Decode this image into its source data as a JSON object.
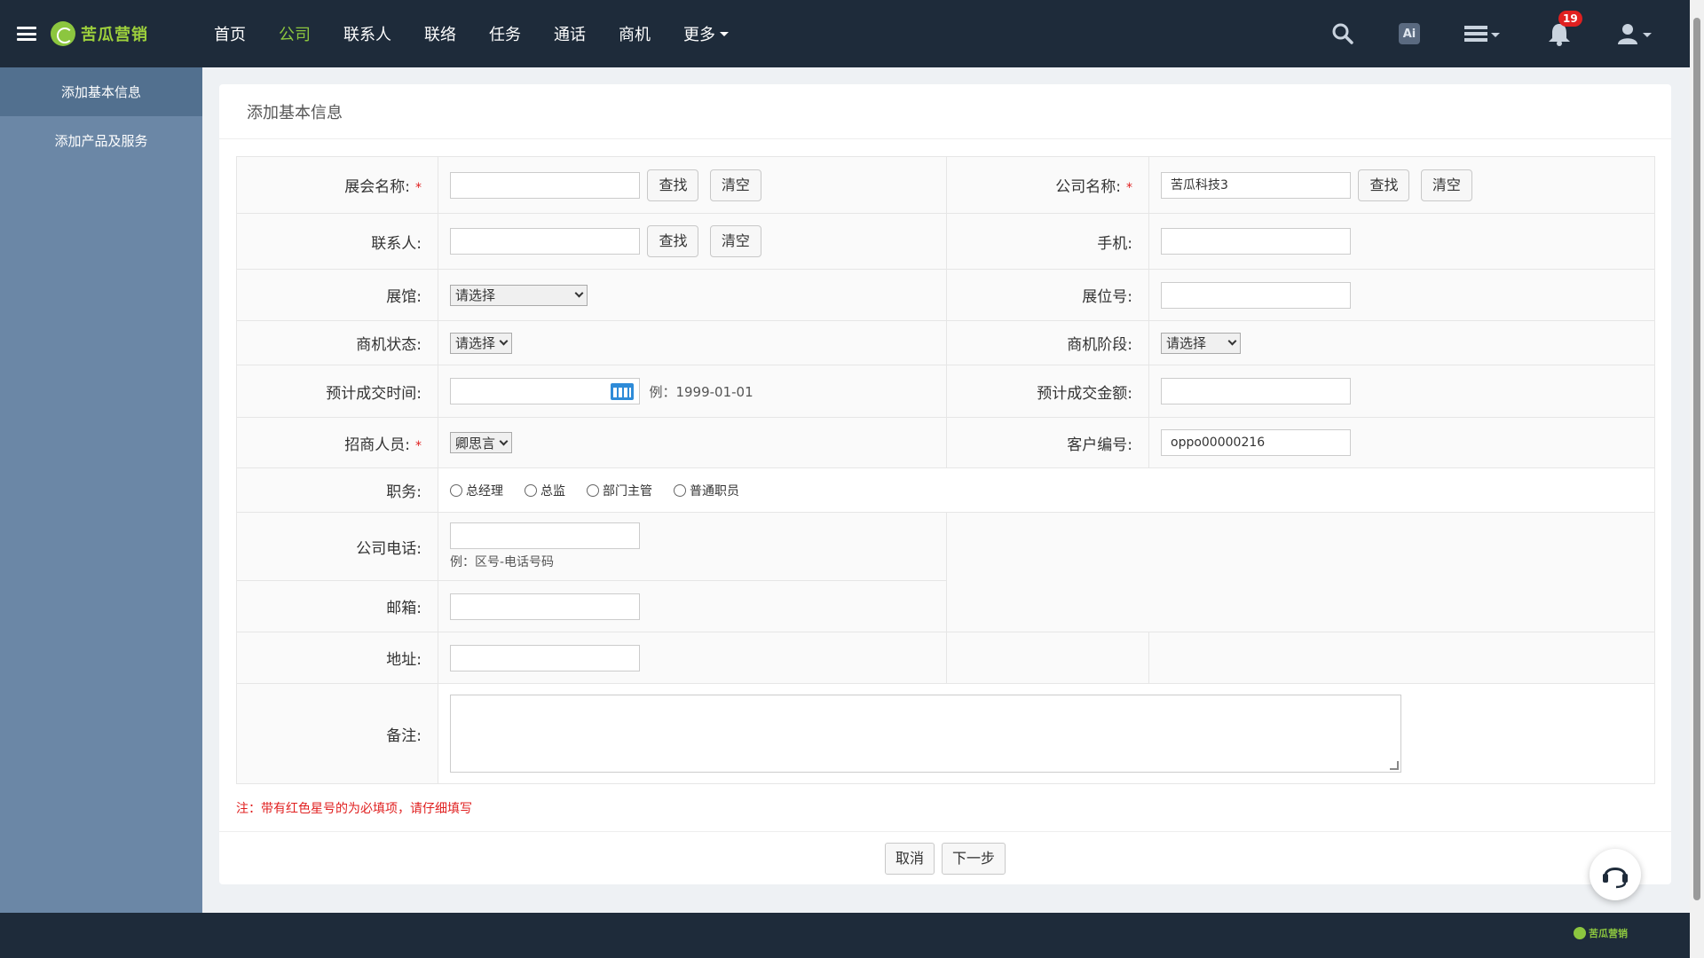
{
  "brand": {
    "name": "苦瓜营销",
    "footer_name": "苦瓜营销"
  },
  "nav": [
    {
      "label": "首页",
      "active": false
    },
    {
      "label": "公司",
      "active": true
    },
    {
      "label": "联系人",
      "active": false
    },
    {
      "label": "联络",
      "active": false
    },
    {
      "label": "任务",
      "active": false
    },
    {
      "label": "通话",
      "active": false
    },
    {
      "label": "商机",
      "active": false
    },
    {
      "label": "更多",
      "active": false
    }
  ],
  "topbar": {
    "ai_label": "Ai",
    "notification_count": "19"
  },
  "sidebar": {
    "items": [
      {
        "label": "添加基本信息",
        "active": true
      },
      {
        "label": "添加产品及服务",
        "active": false
      }
    ]
  },
  "page": {
    "title": "添加基本信息"
  },
  "form": {
    "exhibition_name": {
      "label": "展会名称:",
      "value": ""
    },
    "company_name": {
      "label": "公司名称:",
      "value": "苦瓜科技3"
    },
    "contact": {
      "label": "联系人:",
      "value": ""
    },
    "mobile": {
      "label": "手机:",
      "value": ""
    },
    "hall": {
      "label": "展馆:",
      "selected": "请选择"
    },
    "booth_no": {
      "label": "展位号:",
      "value": ""
    },
    "opp_status": {
      "label": "商机状态:",
      "selected": "请选择"
    },
    "opp_stage": {
      "label": "商机阶段:",
      "selected": "请选择"
    },
    "expected_date": {
      "label": "预计成交时间:",
      "value": "",
      "hint": "例：1999-01-01"
    },
    "expected_amount": {
      "label": "预计成交金额:",
      "value": ""
    },
    "recruiter": {
      "label": "招商人员:",
      "selected": "卿思言"
    },
    "customer_no": {
      "label": "客户编号:",
      "value": "oppo00000216"
    },
    "position": {
      "label": "职务:",
      "options": [
        "总经理",
        "总监",
        "部门主管",
        "普通职员"
      ]
    },
    "company_phone": {
      "label": "公司电话:",
      "value": "",
      "hint": "例：区号-电话号码"
    },
    "email": {
      "label": "邮箱:",
      "value": ""
    },
    "address": {
      "label": "地址:",
      "value": ""
    },
    "remarks": {
      "label": "备注:",
      "value": ""
    },
    "search_label": "查找",
    "clear_label": "清空",
    "required_mark": "*"
  },
  "note": "注：带有红色星号的为必填项，请仔细填写",
  "footer_buttons": {
    "cancel": "取消",
    "next": "下一步"
  },
  "colors": {
    "topbar": "#1e2b3a",
    "sidebar": "#6b87a6",
    "accent": "#8cc63f",
    "required": "#e02020"
  }
}
